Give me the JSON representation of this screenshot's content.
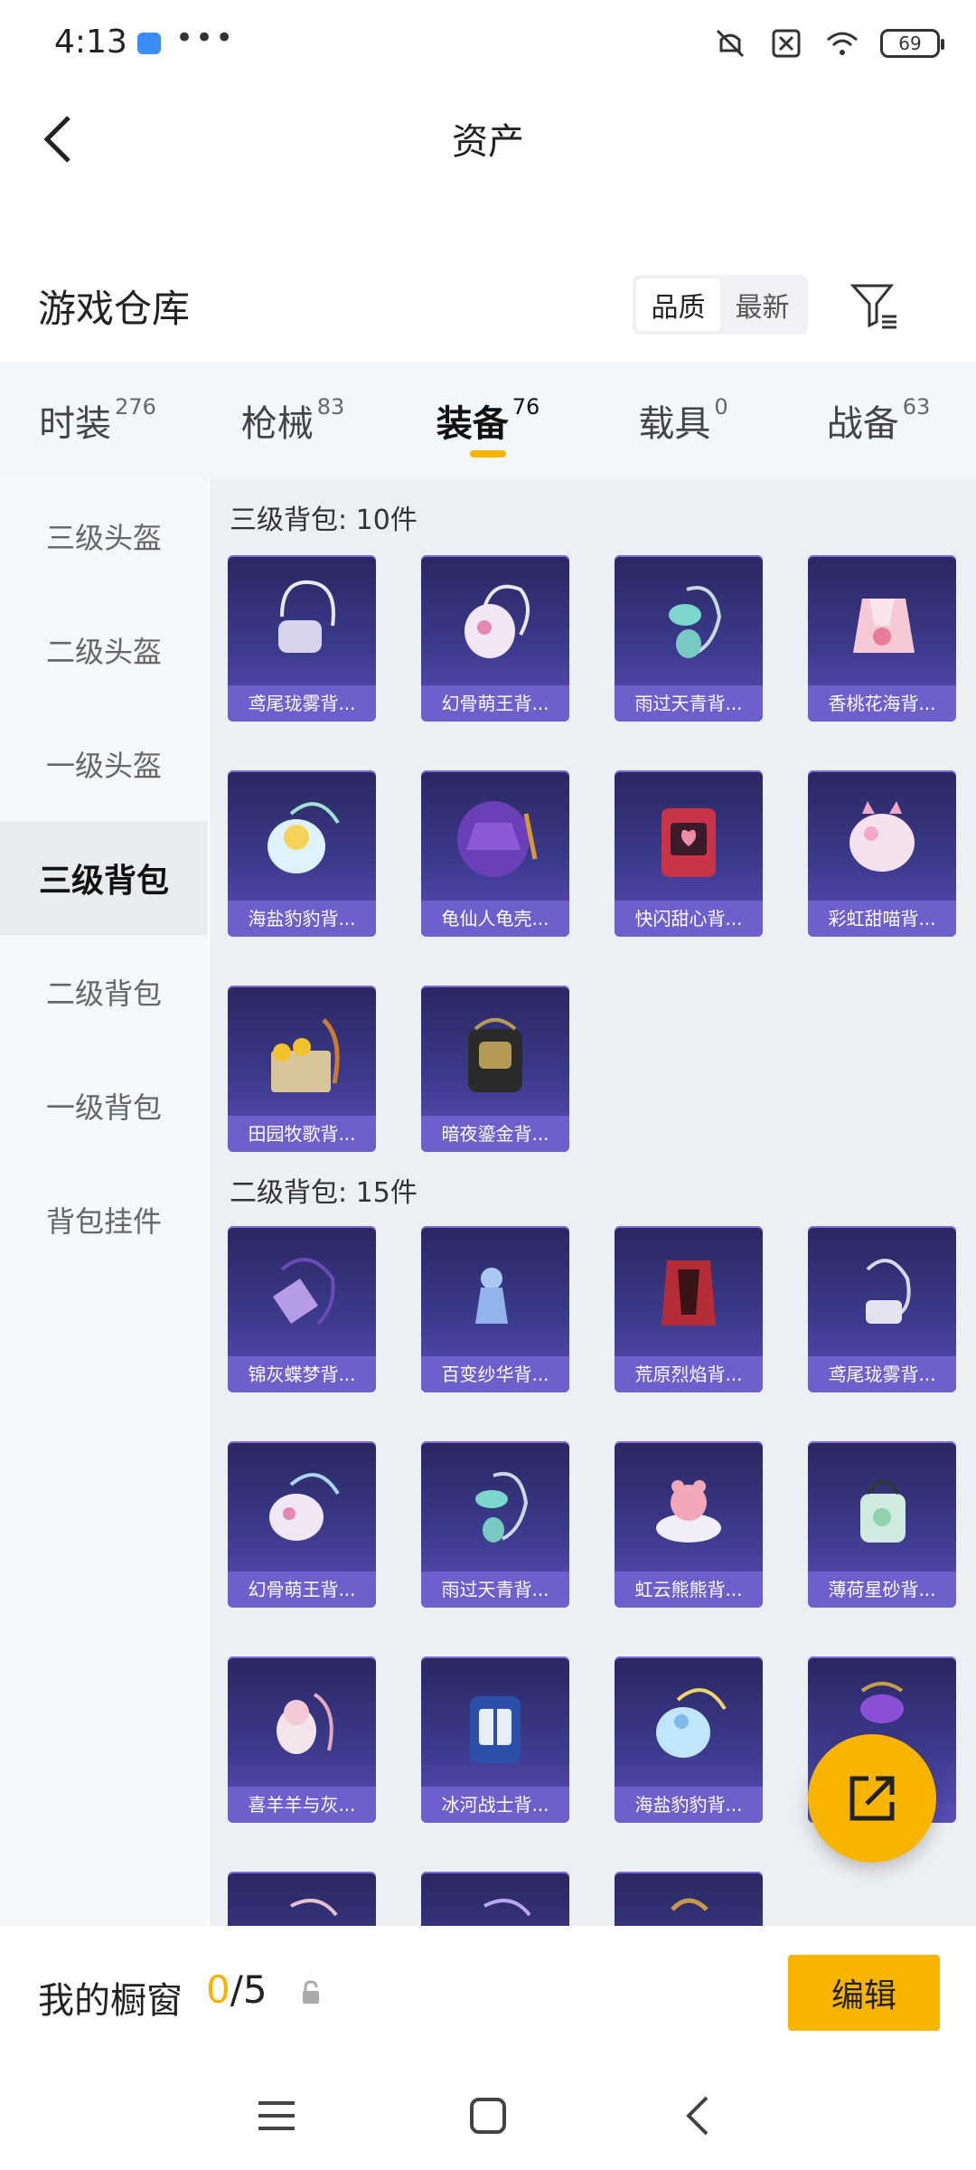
{
  "status_bar": {
    "time": "4:13",
    "more": "•••",
    "battery": "69"
  },
  "header": {
    "title": "资产"
  },
  "warehouse": {
    "title": "游戏仓库",
    "sort_options": [
      "品质",
      "最新"
    ]
  },
  "tabs": [
    {
      "label": "时装",
      "count": "276"
    },
    {
      "label": "枪械",
      "count": "83"
    },
    {
      "label": "装备",
      "count": "76"
    },
    {
      "label": "载具",
      "count": "0"
    },
    {
      "label": "战备",
      "count": "63"
    }
  ],
  "sidebar": {
    "items": [
      "三级头盔",
      "二级头盔",
      "一级头盔",
      "三级背包",
      "二级背包",
      "一级背包",
      "背包挂件"
    ]
  },
  "sections": [
    {
      "title": "三级背包: 10件",
      "items": [
        "鸢尾珑雾背...",
        "幻骨萌王背...",
        "雨过天青背...",
        "香桃花海背...",
        "海盐豹豹背...",
        "龟仙人龟壳...",
        "快闪甜心背...",
        "彩虹甜喵背...",
        "田园牧歌背...",
        "暗夜鎏金背..."
      ]
    },
    {
      "title": "二级背包: 15件",
      "items": [
        "锦灰蝶梦背...",
        "百变纱华背...",
        "荒原烈焰背...",
        "鸢尾珑雾背...",
        "幻骨萌王背...",
        "雨过天青背...",
        "虹云熊熊背...",
        "薄荷星砂背...",
        "喜羊羊与灰...",
        "冰河战士背...",
        "海盐豹豹背..."
      ]
    }
  ],
  "showcase": {
    "label": "我的橱窗",
    "current": "0",
    "total": "/5",
    "edit_label": "编辑"
  },
  "colors": {
    "accent": "#f7b500",
    "card_bg": "#3c3a8c",
    "card_label": "#6d5fcc"
  }
}
